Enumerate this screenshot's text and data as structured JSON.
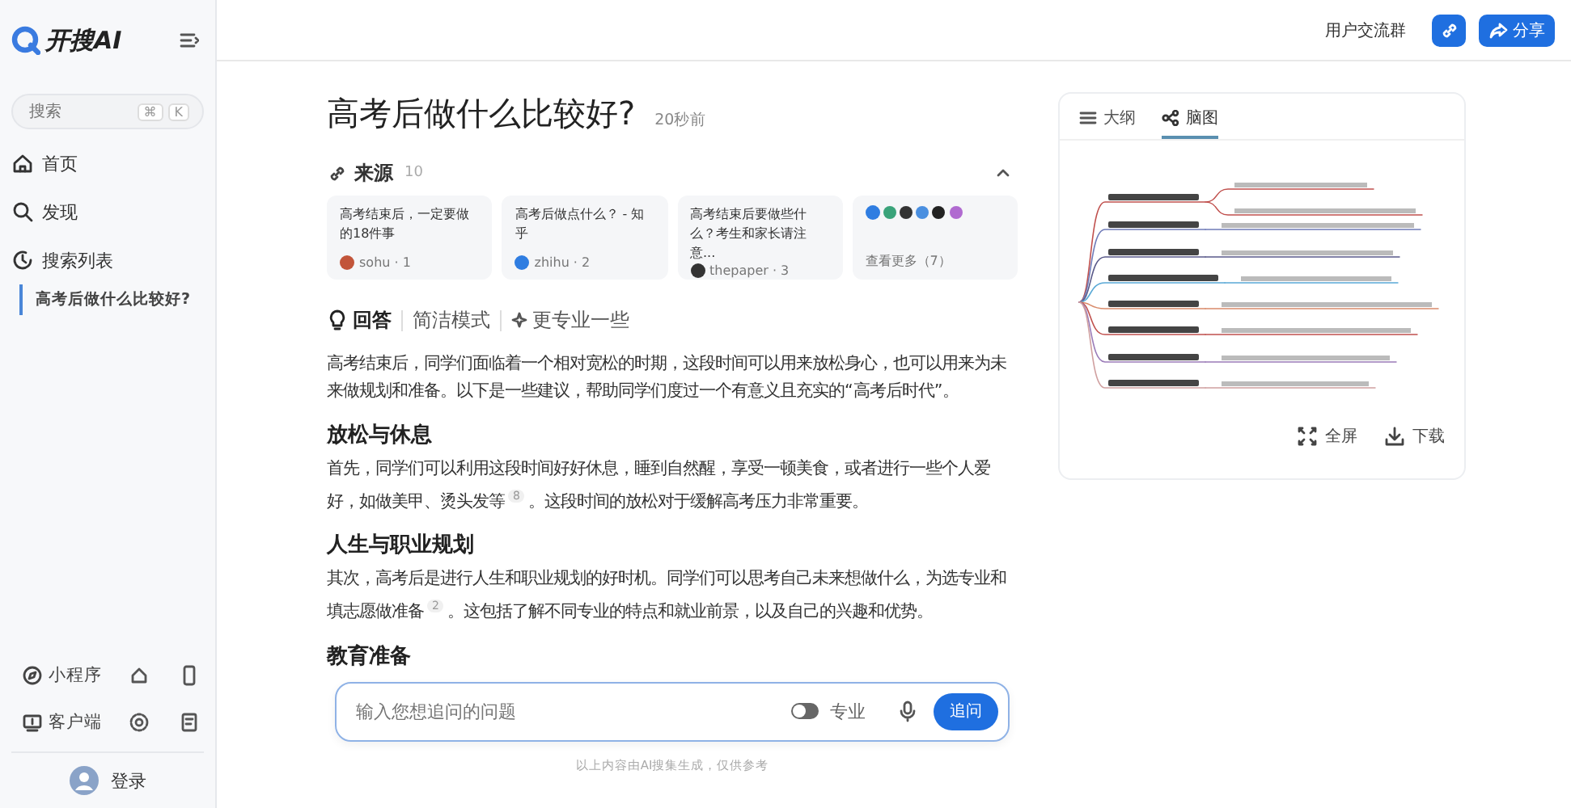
{
  "sidebar": {
    "logo": "开搜AI",
    "search": {
      "placeholder": "搜索",
      "shortcut_keys": [
        "⌘",
        "K"
      ]
    },
    "nav": [
      {
        "label": "首页",
        "selected": false
      },
      {
        "label": "发现",
        "selected": false
      },
      {
        "label": "搜索列表",
        "selected": false
      }
    ],
    "history": [
      {
        "label": "高考后做什么比较好?",
        "selected": true
      }
    ],
    "bottom_links": [
      {
        "label": "小程序"
      },
      {
        "label": "客户端"
      }
    ],
    "login": "登录"
  },
  "header": {
    "group_link": "用户交流群",
    "share_button": "分享"
  },
  "question": {
    "title": "高考后做什么比较好?",
    "time": "20秒前"
  },
  "sources": {
    "title": "来源",
    "count": "10",
    "expanded": true,
    "cards": [
      {
        "title": "高考结束后，一定要做的18件事",
        "site": "sohu · 1",
        "color": "#c2553a"
      },
      {
        "title": "高考后做点什么？ - 知乎",
        "site": "zhihu · 2",
        "color": "#2f7de1"
      },
      {
        "title": "高考结束后要做些什么？考生和家长请注意...",
        "site": "thepaper · 3",
        "color": "#333333"
      }
    ],
    "more": {
      "label": "查看更多（7）"
    }
  },
  "answer_tabs": [
    {
      "label": "回答",
      "selected": true
    },
    {
      "label": "简洁模式",
      "selected": false
    },
    {
      "label": "更专业一些",
      "selected": false
    }
  ],
  "answer": [
    {
      "kind": "paragraph",
      "text": "高考结束后，同学们面临着一个相对宽松的时期，这段时间可以用来放松身心，也可以用来为未来做规划和准备。以下是一些建议，帮助同学们度过一个有意义且充实的“高考后时代”。"
    },
    {
      "kind": "heading",
      "text": "放松与休息"
    },
    {
      "kind": "paragraph",
      "text": "首先，同学们可以利用这段时间好好休息，睡到自然醒，享受一顿美食，或者进行一些个人爱好，如做美甲、烫头发等",
      "ref": "8",
      "after": "。这段时间的放松对于缓解高考压力非常重要。"
    },
    {
      "kind": "heading",
      "text": "人生与职业规划"
    },
    {
      "kind": "paragraph",
      "text": "其次，高考后是进行人生和职业规划的好时机。同学们可以思考自己未来想做什么，为选专业和填志愿做准备",
      "ref": "2",
      "after": "。这包括了解不同专业的特点和就业前景，以及自己的兴趣和优势。"
    },
    {
      "kind": "heading",
      "text": "教育准备"
    }
  ],
  "followup": {
    "placeholder": "输入您想追问的问题",
    "pro_label": "专业",
    "pro_on": false,
    "submit": "追问"
  },
  "disclaimer": "以上内容由AI搜集生成，仅供参考",
  "mindmap_panel": {
    "tabs": [
      {
        "label": "大纲",
        "selected": false
      },
      {
        "label": "脑图",
        "selected": true
      }
    ],
    "actions": [
      {
        "label": "全屏"
      },
      {
        "label": "下载"
      }
    ]
  }
}
